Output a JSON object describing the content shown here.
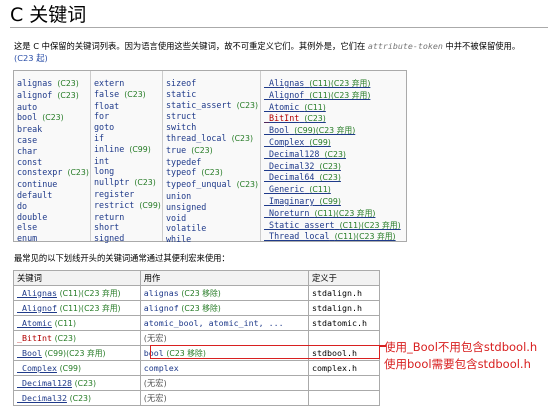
{
  "page": {
    "title": "C 关键词",
    "intro_pre": "这是 C 中保留的关键词列表。因为语言使用这些关键词，故不可重定义它们。其例外是，它们在 ",
    "intro_kw": "attribute-token",
    "intro_post": " 中并不被保留使用。",
    "intro_link": "(C23 起)",
    "para2": "最常见的以下划线开头的关键词通常通过其便利宏来使用："
  },
  "keywords": {
    "col1": [
      {
        "k": "alignas",
        "tag": "(C23)"
      },
      {
        "k": "alignof",
        "tag": "(C23)"
      },
      {
        "k": "auto",
        "tag": ""
      },
      {
        "k": "bool",
        "tag": "(C23)"
      },
      {
        "k": "break",
        "tag": ""
      },
      {
        "k": "case",
        "tag": ""
      },
      {
        "k": "char",
        "tag": ""
      },
      {
        "k": "const",
        "tag": ""
      },
      {
        "k": "constexpr",
        "tag": "(C23)"
      },
      {
        "k": "continue",
        "tag": ""
      },
      {
        "k": "default",
        "tag": ""
      },
      {
        "k": "do",
        "tag": ""
      },
      {
        "k": "double",
        "tag": ""
      },
      {
        "k": "else",
        "tag": ""
      },
      {
        "k": "enum",
        "tag": ""
      }
    ],
    "col2": [
      {
        "k": "extern",
        "tag": ""
      },
      {
        "k": "false",
        "tag": "(C23)"
      },
      {
        "k": "float",
        "tag": ""
      },
      {
        "k": "for",
        "tag": ""
      },
      {
        "k": "goto",
        "tag": ""
      },
      {
        "k": "if",
        "tag": ""
      },
      {
        "k": "inline",
        "tag": "(C99)"
      },
      {
        "k": "int",
        "tag": ""
      },
      {
        "k": "long",
        "tag": ""
      },
      {
        "k": "nullptr",
        "tag": "(C23)"
      },
      {
        "k": "register",
        "tag": ""
      },
      {
        "k": "restrict",
        "tag": "(C99)"
      },
      {
        "k": "return",
        "tag": ""
      },
      {
        "k": "short",
        "tag": ""
      },
      {
        "k": "signed",
        "tag": ""
      }
    ],
    "col3": [
      {
        "k": "sizeof",
        "tag": ""
      },
      {
        "k": "static",
        "tag": ""
      },
      {
        "k": "static_assert",
        "tag": "(C23)"
      },
      {
        "k": "struct",
        "tag": ""
      },
      {
        "k": "switch",
        "tag": ""
      },
      {
        "k": "thread_local",
        "tag": "(C23)"
      },
      {
        "k": "true",
        "tag": "(C23)"
      },
      {
        "k": "typedef",
        "tag": ""
      },
      {
        "k": "typeof",
        "tag": "(C23)"
      },
      {
        "k": "typeof_unqual",
        "tag": "(C23)"
      },
      {
        "k": "union",
        "tag": ""
      },
      {
        "k": "unsigned",
        "tag": ""
      },
      {
        "k": "void",
        "tag": ""
      },
      {
        "k": "volatile",
        "tag": ""
      },
      {
        "k": "while",
        "tag": ""
      }
    ],
    "col4": [
      {
        "k": "_Alignas",
        "tag": "(C11)(C23 弃用)"
      },
      {
        "k": "_Alignof",
        "tag": "(C11)(C23 弃用)"
      },
      {
        "k": "_Atomic",
        "tag": "(C11)"
      },
      {
        "k": "_BitInt",
        "tag": "(C23)"
      },
      {
        "k": "_Bool",
        "tag": "(C99)(C23 弃用)"
      },
      {
        "k": "_Complex",
        "tag": "(C99)"
      },
      {
        "k": "_Decimal128",
        "tag": "(C23)"
      },
      {
        "k": "_Decimal32",
        "tag": "(C23)"
      },
      {
        "k": "_Decimal64",
        "tag": "(C23)"
      },
      {
        "k": "_Generic",
        "tag": "(C11)"
      },
      {
        "k": "_Imaginary",
        "tag": "(C99)"
      },
      {
        "k": "_Noreturn",
        "tag": "(C11)(C23 弃用)"
      },
      {
        "k": "_Static_assert",
        "tag": "(C11)(C23 弃用)"
      },
      {
        "k": "_Thread_local",
        "tag": "(C11)(C23 弃用)"
      }
    ]
  },
  "macro_table": {
    "headers": [
      "关键词",
      "用作",
      "定义于"
    ],
    "rows": [
      {
        "kw": "_Alignas",
        "kwtag": "(C11)(C23 弃用)",
        "use": "alignas",
        "usetag": "(C23 移除)",
        "def": "stdalign.h"
      },
      {
        "kw": "_Alignof",
        "kwtag": "(C11)(C23 弃用)",
        "use": "alignof",
        "usetag": "(C23 移除)",
        "def": "stdalign.h"
      },
      {
        "kw": "_Atomic",
        "kwtag": "(C11)",
        "use": "atomic_bool, atomic_int, ...",
        "usetag": "",
        "def": "stdatomic.h"
      },
      {
        "kw": "_BitInt",
        "kwtag": "(C23)",
        "use": "(无宏)",
        "usetag": "",
        "def": ""
      },
      {
        "kw": "_Bool",
        "kwtag": "(C99)(C23 弃用)",
        "use": "bool",
        "usetag": "(C23 移除)",
        "def": "stdbool.h"
      },
      {
        "kw": "_Complex",
        "kwtag": "(C99)",
        "use": "complex",
        "usetag": "",
        "def": "complex.h"
      },
      {
        "kw": "_Decimal128",
        "kwtag": "(C23)",
        "use": "(无宏)",
        "usetag": "",
        "def": ""
      },
      {
        "kw": "_Decimal32",
        "kwtag": "(C23)",
        "use": "(无宏)",
        "usetag": "",
        "def": ""
      }
    ]
  },
  "annotations": {
    "note1": "使用_Bool不用包含stdbool.h",
    "note2": "使用bool需要包含stdbool.h"
  }
}
